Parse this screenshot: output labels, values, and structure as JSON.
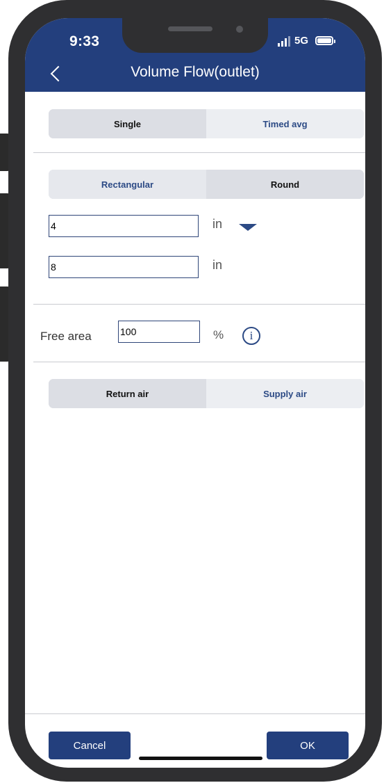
{
  "status_bar": {
    "time": "9:33",
    "network": "5G",
    "icons": [
      "signal-icon",
      "battery-icon"
    ]
  },
  "header": {
    "title": "Volume Flow(outlet)",
    "back_icon": "chevron-left-icon"
  },
  "measurement_mode": {
    "options": [
      "Single",
      "Timed avg"
    ],
    "selected": "Single"
  },
  "duct_shape": {
    "options": [
      "Rectangular",
      "Round"
    ],
    "selected": "Round"
  },
  "dimensions": {
    "width_value": "4",
    "width_unit": "in",
    "height_value": "8",
    "height_unit": "in"
  },
  "free_area": {
    "label": "Free area",
    "value": "100",
    "unit": "%"
  },
  "air_type": {
    "options": [
      "Return air",
      "Supply air"
    ],
    "selected": "Return air"
  },
  "footer": {
    "cancel_label": "Cancel",
    "ok_label": "OK"
  },
  "colors": {
    "header_bg": "#233f7d",
    "accent": "#2c4a85",
    "segment_selected": "#dcdee4",
    "segment_unselected": "#eceef2"
  }
}
